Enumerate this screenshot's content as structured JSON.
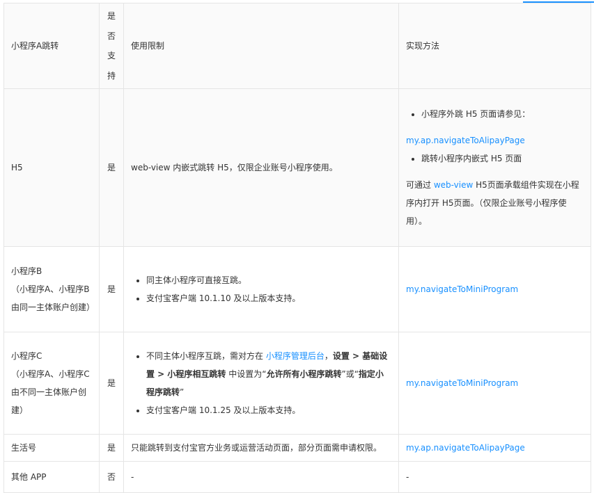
{
  "header": {
    "col1": "小程序A跳转",
    "col2_chars": [
      "是",
      "否",
      "支",
      "持"
    ],
    "col3": "使用限制",
    "col4": "实现方法"
  },
  "rows": {
    "h5": {
      "name": "H5",
      "support": "是",
      "limit": "web-view 内嵌式跳转 H5，仅限企业账号小程序使用。",
      "method": {
        "bullet1": "小程序外跳 H5 页面请参见：",
        "link1": "my.ap.navigateToAlipayPage",
        "bullet2": "跳转小程序内嵌式 H5 页面",
        "para_prefix": "可通过 ",
        "para_link": "web-view",
        "para_suffix": " H5页面承载组件实现在小程序内打开 H5页面。（仅限企业账号小程序使用）。"
      }
    },
    "b": {
      "name_lines": [
        "小程序B",
        "（小程序A、小程序B由同一主体账户创建）"
      ],
      "support": "是",
      "limits": [
        "同主体小程序可直接互跳。",
        "支付宝客户端 10.1.10 及以上版本支持。"
      ],
      "method": "my.navigateToMiniProgram"
    },
    "c": {
      "name_lines": [
        "小程序C",
        "（小程序A、小程序C由不同一主体账户创建）"
      ],
      "support": "是",
      "limit1": {
        "pre": "不同主体小程序互跳，需对方在 ",
        "link": "小程序管理后台",
        "comma": "，",
        "bold1": "设置 > 基础设置 > 小程序相互跳转",
        "mid": " 中设置为“",
        "bold2": "允许所有小程序跳转",
        "or": "”或“",
        "bold3": "指定小程序跳转",
        "end": "”"
      },
      "limit2": "支付宝客户端 10.1.25 及以上版本支持。",
      "method": "my.navigateToMiniProgram"
    },
    "life": {
      "name": "生活号",
      "support": "是",
      "limit": "只能跳转到支付宝官方业务或运营活动页面，部分页面需申请权限。",
      "method": "my.ap.navigateToAlipayPage"
    },
    "other": {
      "name": "其他 APP",
      "support": "否",
      "limit": "-",
      "method": "-"
    }
  },
  "colors": {
    "link": "#1890ff",
    "border": "#e5e5e5",
    "header_bg": "#fafafa",
    "text": "#333333"
  }
}
